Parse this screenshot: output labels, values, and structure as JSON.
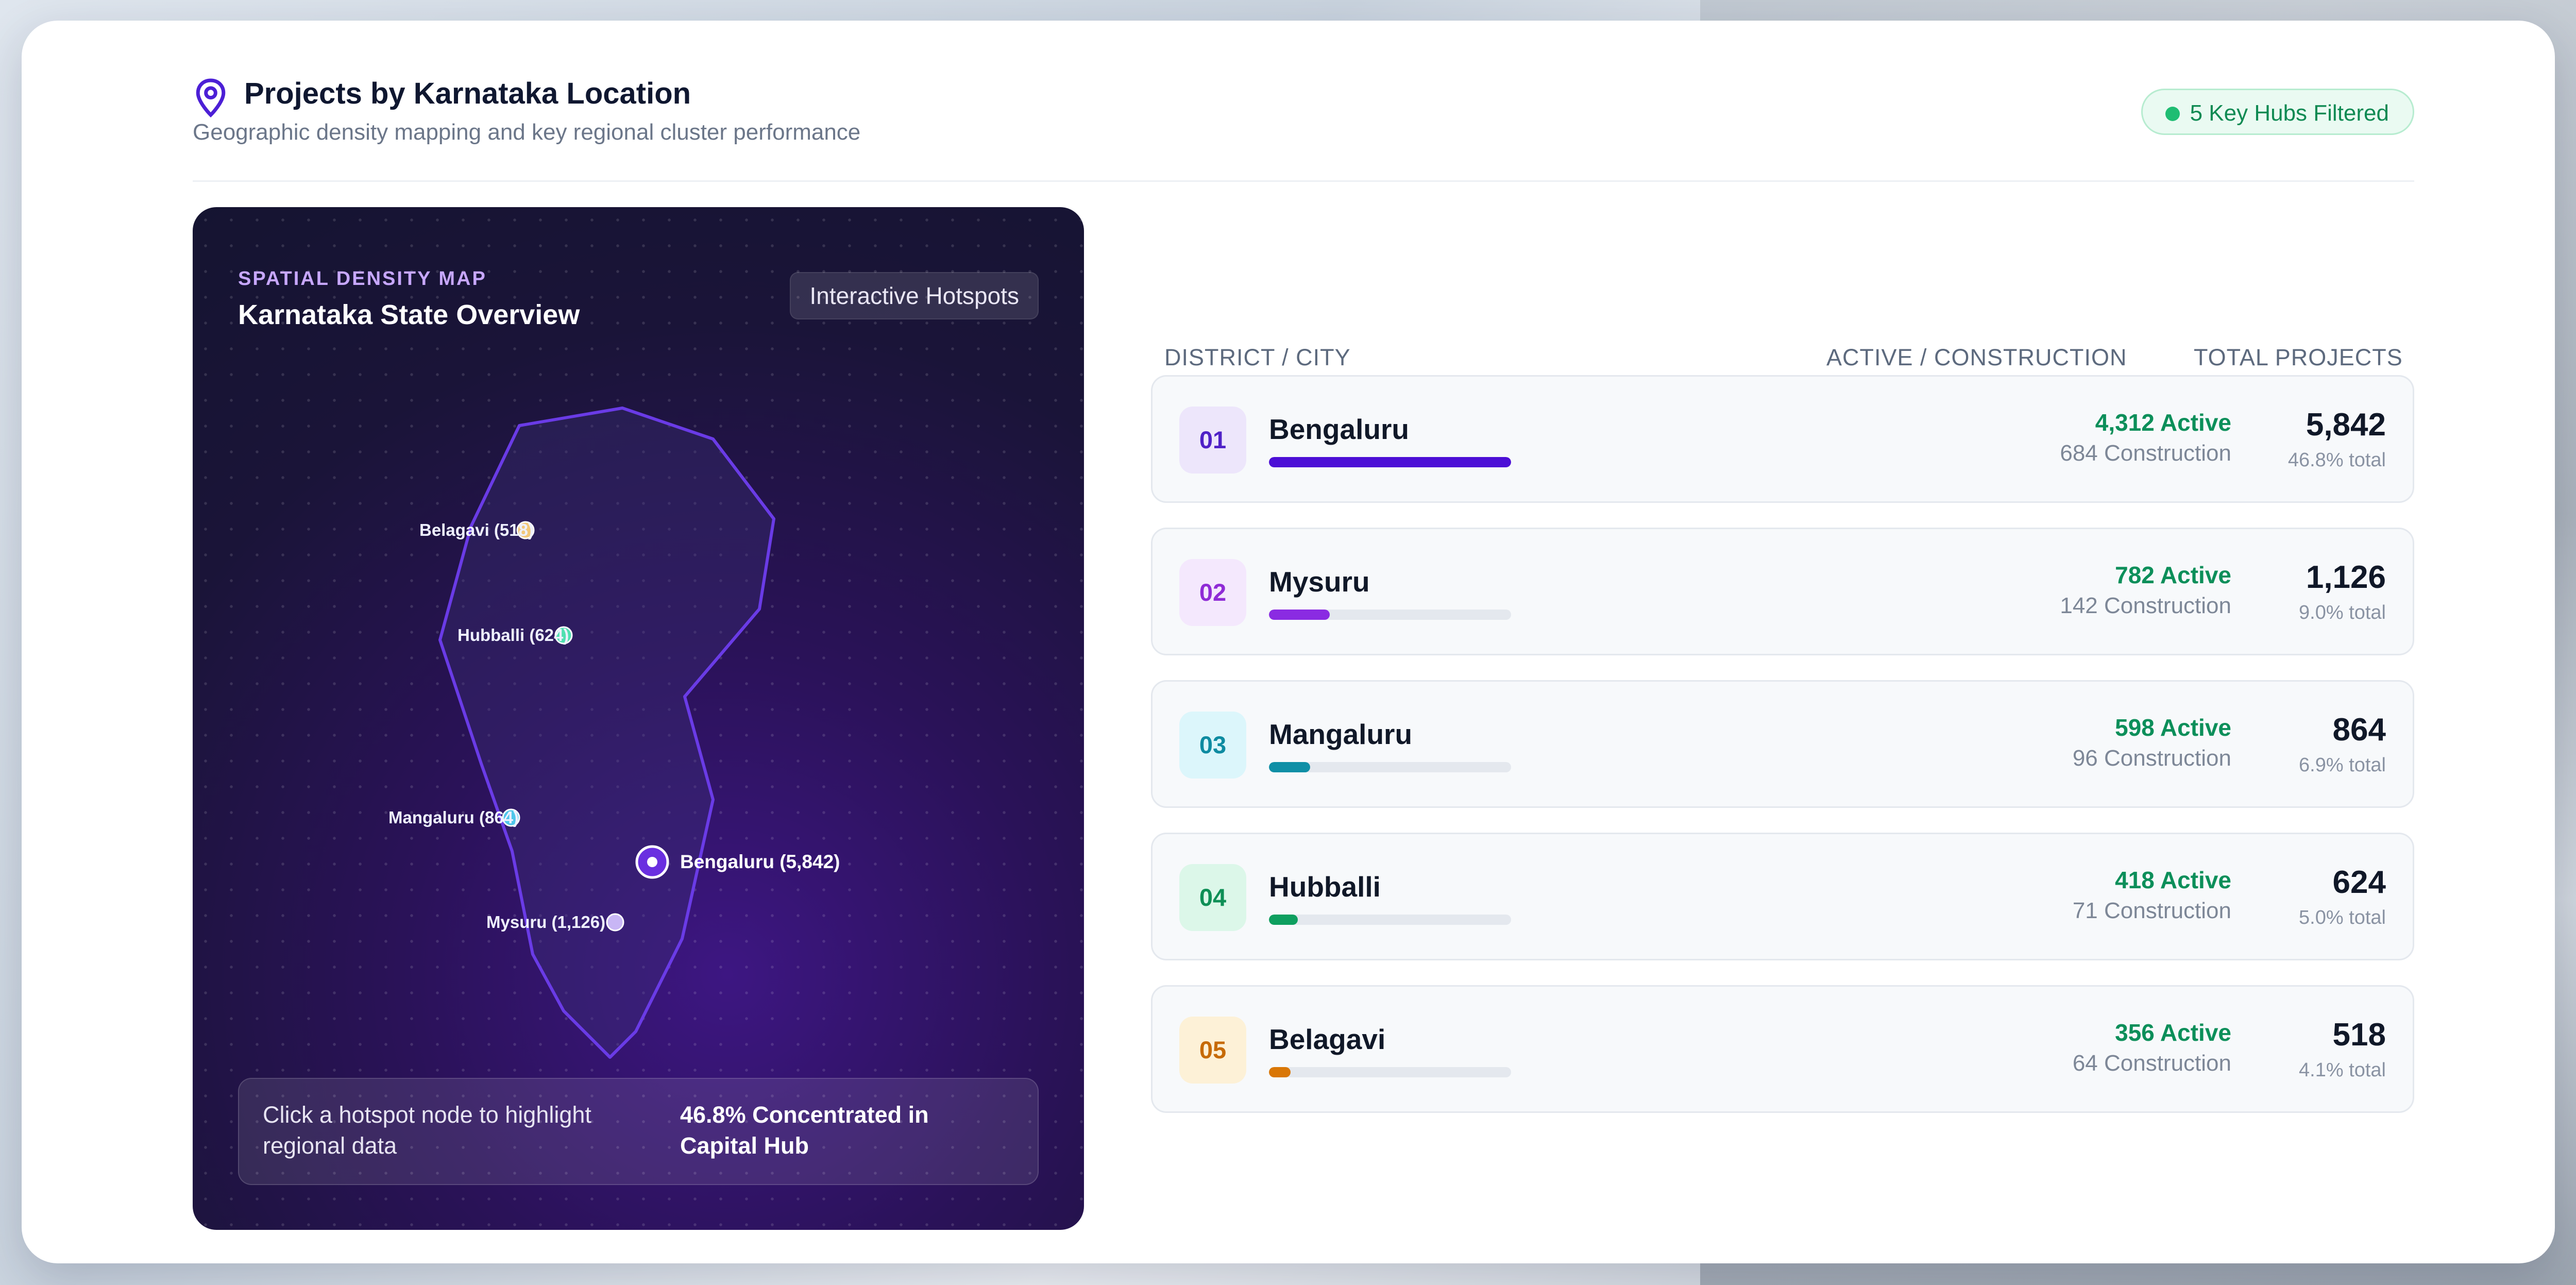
{
  "header": {
    "title": "Projects by Karnataka Location",
    "subtitle": "Geographic density mapping and key regional cluster performance",
    "badge": "5 Key Hubs Filtered",
    "badge_color": "#1fbd73"
  },
  "map": {
    "kicker": "SPATIAL DENSITY MAP",
    "title": "Karnataka State Overview",
    "hotspots_button": "Interactive Hotspots",
    "labels": {
      "belagavi": "Belagavi (518)",
      "hubballi": "Hubballi (624)",
      "mangaluru": "Mangaluru (864)",
      "bengaluru": "Bengaluru (5,842)",
      "mysuru": "Mysuru (1,126)"
    },
    "insight_left": "Click a hotspot node to highlight regional data",
    "insight_right": "46.8% Concentrated in Capital Hub"
  },
  "table": {
    "headers": {
      "district": "DISTRICT / CITY",
      "active": "ACTIVE / CONSTRUCTION",
      "total": "TOTAL PROJECTS"
    },
    "rows": [
      {
        "rank": "01",
        "city": "Bengaluru",
        "active": "4,312 Active",
        "construction": "684 Construction",
        "total": "5,842",
        "pct": "46.8% total",
        "bar_fraction": 1.0,
        "color": "#4c0fd6",
        "rank_bg": "#ede6fb",
        "rank_fg": "#4f21c7"
      },
      {
        "rank": "02",
        "city": "Mysuru",
        "active": "782 Active",
        "construction": "142 Construction",
        "total": "1,126",
        "pct": "9.0% total",
        "bar_fraction": 0.25,
        "color": "#8a2be2",
        "rank_bg": "#f4e8fd",
        "rank_fg": "#8f2bd6"
      },
      {
        "rank": "03",
        "city": "Mangaluru",
        "active": "598 Active",
        "construction": "96 Construction",
        "total": "864",
        "pct": "6.9% total",
        "bar_fraction": 0.17,
        "color": "#0f8fa6",
        "rank_bg": "#dcf6fb",
        "rank_fg": "#0e8ba1"
      },
      {
        "rank": "04",
        "city": "Hubballi",
        "active": "418 Active",
        "construction": "71 Construction",
        "total": "624",
        "pct": "5.0% total",
        "bar_fraction": 0.12,
        "color": "#0e9f5f",
        "rank_bg": "#dcf7e9",
        "rank_fg": "#0e8f56"
      },
      {
        "rank": "05",
        "city": "Belagavi",
        "active": "356 Active",
        "construction": "64 Construction",
        "total": "518",
        "pct": "4.1% total",
        "bar_fraction": 0.09,
        "color": "#d97706",
        "rank_bg": "#fdf1d7",
        "rank_fg": "#c66a06"
      }
    ]
  }
}
